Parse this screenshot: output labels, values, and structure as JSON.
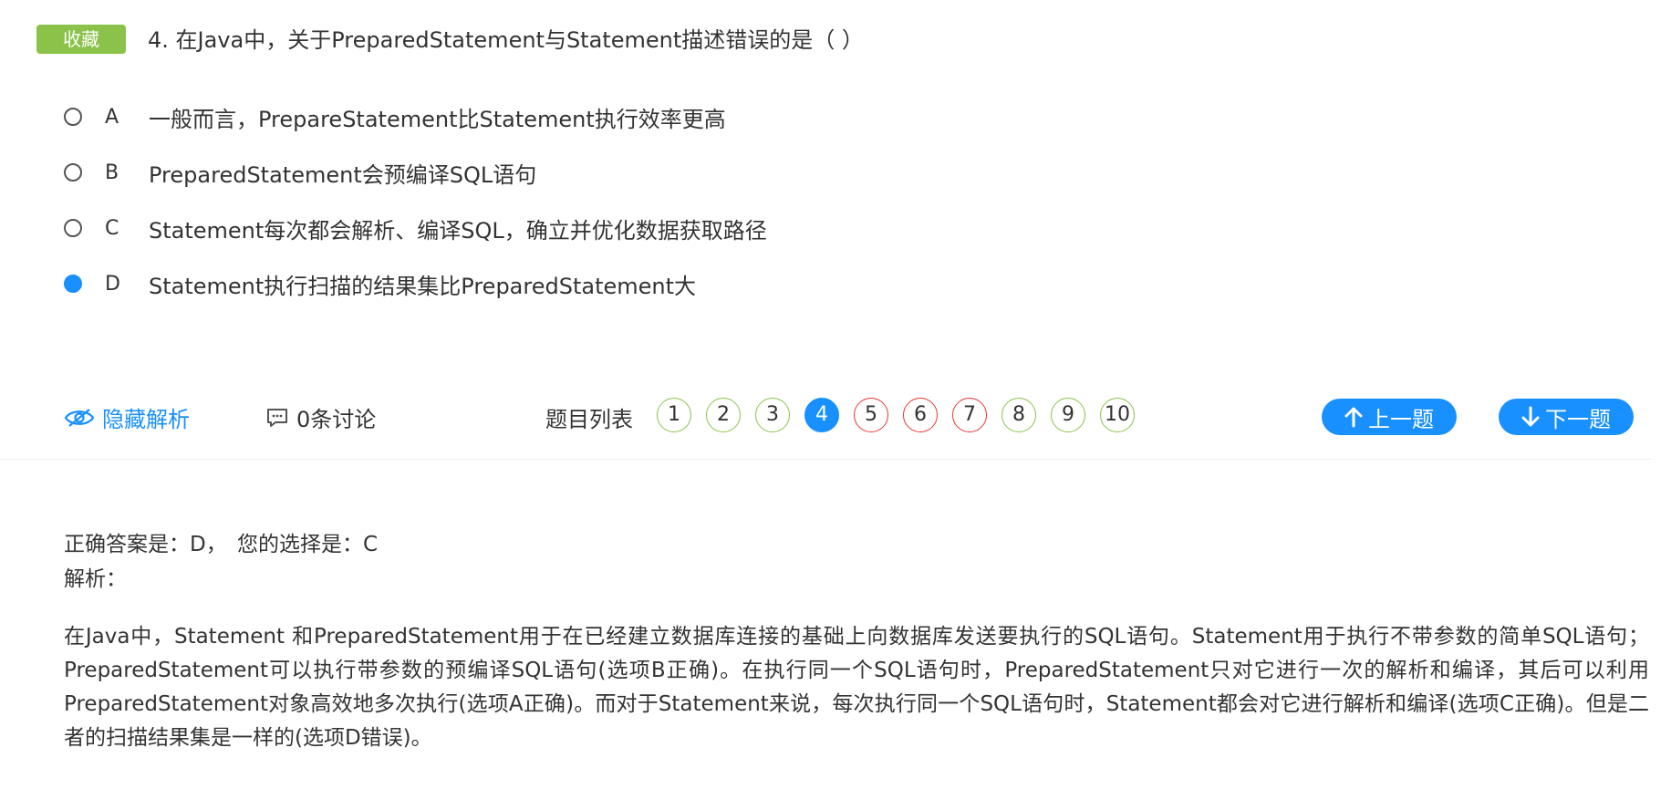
{
  "question": {
    "favorite_label": "收藏",
    "title": "4. 在Java中，关于PreparedStatement与Statement描述错误的是（ ）",
    "options": [
      {
        "letter": "A",
        "text": "一般而言，PrepareStatement比Statement执行效率更高",
        "selected": false
      },
      {
        "letter": "B",
        "text": "PreparedStatement会预编译SQL语句",
        "selected": false
      },
      {
        "letter": "C",
        "text": "Statement每次都会解析、编译SQL，确立并优化数据获取路径",
        "selected": false
      },
      {
        "letter": "D",
        "text": "Statement执行扫描的结果集比PreparedStatement大",
        "selected": true
      }
    ]
  },
  "toolbar": {
    "hide_analysis_label": "隐藏解析",
    "discussion_label": "0条讨论",
    "question_list_label": "题目列表",
    "question_numbers": [
      {
        "num": "1",
        "state": "correct"
      },
      {
        "num": "2",
        "state": "correct"
      },
      {
        "num": "3",
        "state": "correct"
      },
      {
        "num": "4",
        "state": "current"
      },
      {
        "num": "5",
        "state": "wrong"
      },
      {
        "num": "6",
        "state": "wrong"
      },
      {
        "num": "7",
        "state": "wrong"
      },
      {
        "num": "8",
        "state": "correct"
      },
      {
        "num": "9",
        "state": "correct"
      },
      {
        "num": "10",
        "state": "correct"
      }
    ],
    "prev_label": "上一题",
    "next_label": "下一题"
  },
  "answer": {
    "correct_answer": "正确答案是：D，",
    "your_choice": "您的选择是：C",
    "analysis_label": "解析：",
    "analysis_text": "在Java中，Statement 和PreparedStatement用于在已经建立数据库连接的基础上向数据库发送要执行的SQL语句。Statement用于执行不带参数的简单SQL语句； PreparedStatement可以执行带参数的预编译SQL语句(选项B正确)。在执行同一个SQL语句时，PreparedStatement只对它进行一次的解析和编译，其后可以利用PreparedStatement对象高效地多次执行(选项A正确)。而对于Statement来说，每次执行同一个SQL语句时，Statement都会对它进行解析和编译(选项C正确)。但是二者的扫描结果集是一样的(选项D错误)。"
  },
  "colors": {
    "accent": "#1890ff",
    "badge_green": "#8bc34a",
    "wrong_red": "#e53935",
    "text": "#333333"
  }
}
